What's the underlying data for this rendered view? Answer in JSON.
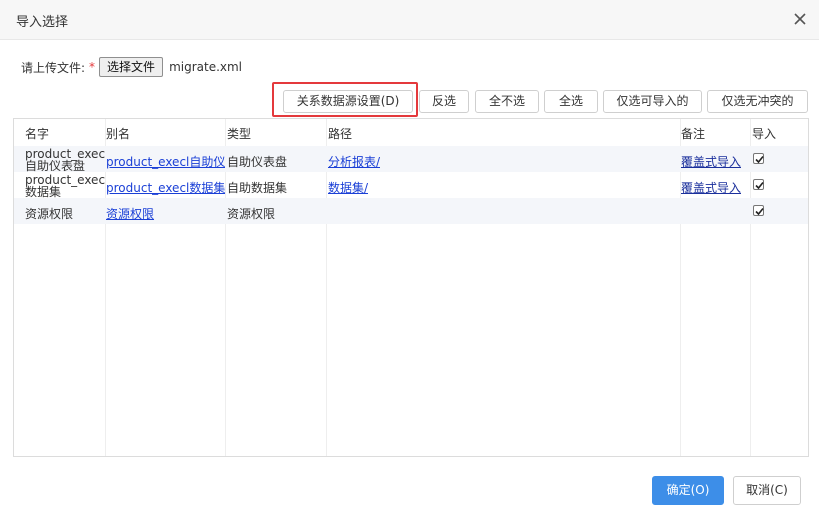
{
  "dialog": {
    "title": "导入选择",
    "close_icon": "close-icon"
  },
  "upload": {
    "label": "请上传文件:",
    "required_mark": "*",
    "choose_file_label": "选择文件",
    "file_name": "migrate.xml"
  },
  "toolbar": {
    "datasource_settings": "关系数据源设置(D)",
    "invert_selection": "反选",
    "select_none": "全不选",
    "select_all": "全选",
    "select_importable": "仅选可导入的",
    "select_no_conflict": "仅选无冲突的"
  },
  "table": {
    "columns": {
      "name": "名字",
      "alias": "别名",
      "type": "类型",
      "path": "路径",
      "remark": "备注",
      "import": "导入"
    },
    "rows": [
      {
        "name_line1": "product_execl",
        "name_line2": "自助仪表盘",
        "alias": "product_execl自助仪表",
        "type": "自助仪表盘",
        "path": "分析报表/",
        "remark": "覆盖式导入",
        "checked": true
      },
      {
        "name_line1": "product_execl",
        "name_line2": "数据集",
        "alias": "product_execl数据集",
        "type": "自助数据集",
        "path": "数据集/",
        "remark": "覆盖式导入",
        "checked": true
      },
      {
        "name": "资源权限",
        "alias": "资源权限",
        "type": "资源权限",
        "path": "",
        "remark": "",
        "checked": true
      }
    ]
  },
  "footer": {
    "confirm": "确定(O)",
    "cancel": "取消(C)"
  },
  "colors": {
    "primary": "#3d8ee8",
    "link": "#1a3fd6",
    "highlight": "#e4393c",
    "row_shade": "#f4f6fa"
  }
}
